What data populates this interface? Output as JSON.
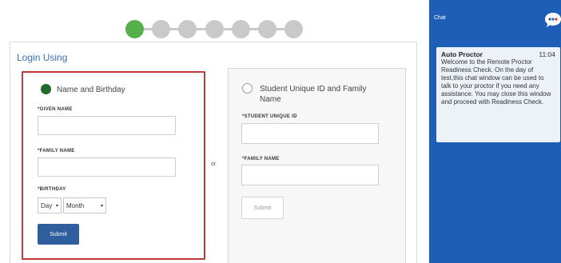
{
  "progress": {
    "total_steps": 7,
    "current_step": 1
  },
  "login": {
    "title": "Login Using",
    "separator": "or",
    "option_name_birthday": {
      "label": "Name and Birthday",
      "selected": true,
      "given_name_label": "*GIVEN NAME",
      "given_name_value": "",
      "family_name_label": "*FAMILY NAME",
      "family_name_value": "",
      "birthday_label": "*BIRTHDAY",
      "day_select": "Day",
      "month_select": "Month",
      "submit_label": "Submit"
    },
    "option_student_id": {
      "label": "Student Unique ID and Family Name",
      "selected": false,
      "student_id_label": "*STUDENT UNIQUE ID",
      "student_id_value": "",
      "family_name_label": "*FAMILY NAME",
      "family_name_value": "",
      "submit_label": "Submit"
    }
  },
  "chat": {
    "title": "Chat",
    "icon": "chat-bubble-icon",
    "messages": [
      {
        "sender": "Auto Proctor",
        "time": "11:04",
        "text": "Welcome to the Remote Proctor Readiness Check. On the day of test,this chat window can be used to talk to your proctor if you need any assistance. You may close this window and proceed with Readiness Check."
      }
    ]
  },
  "colors": {
    "progress_active": "#56b04a",
    "progress_inactive": "#c9c9c9",
    "selected_border": "#c0393b",
    "primary_button": "#2f5e9e",
    "chat_panel": "#1f5eb6",
    "title_link": "#3a6fb0"
  }
}
